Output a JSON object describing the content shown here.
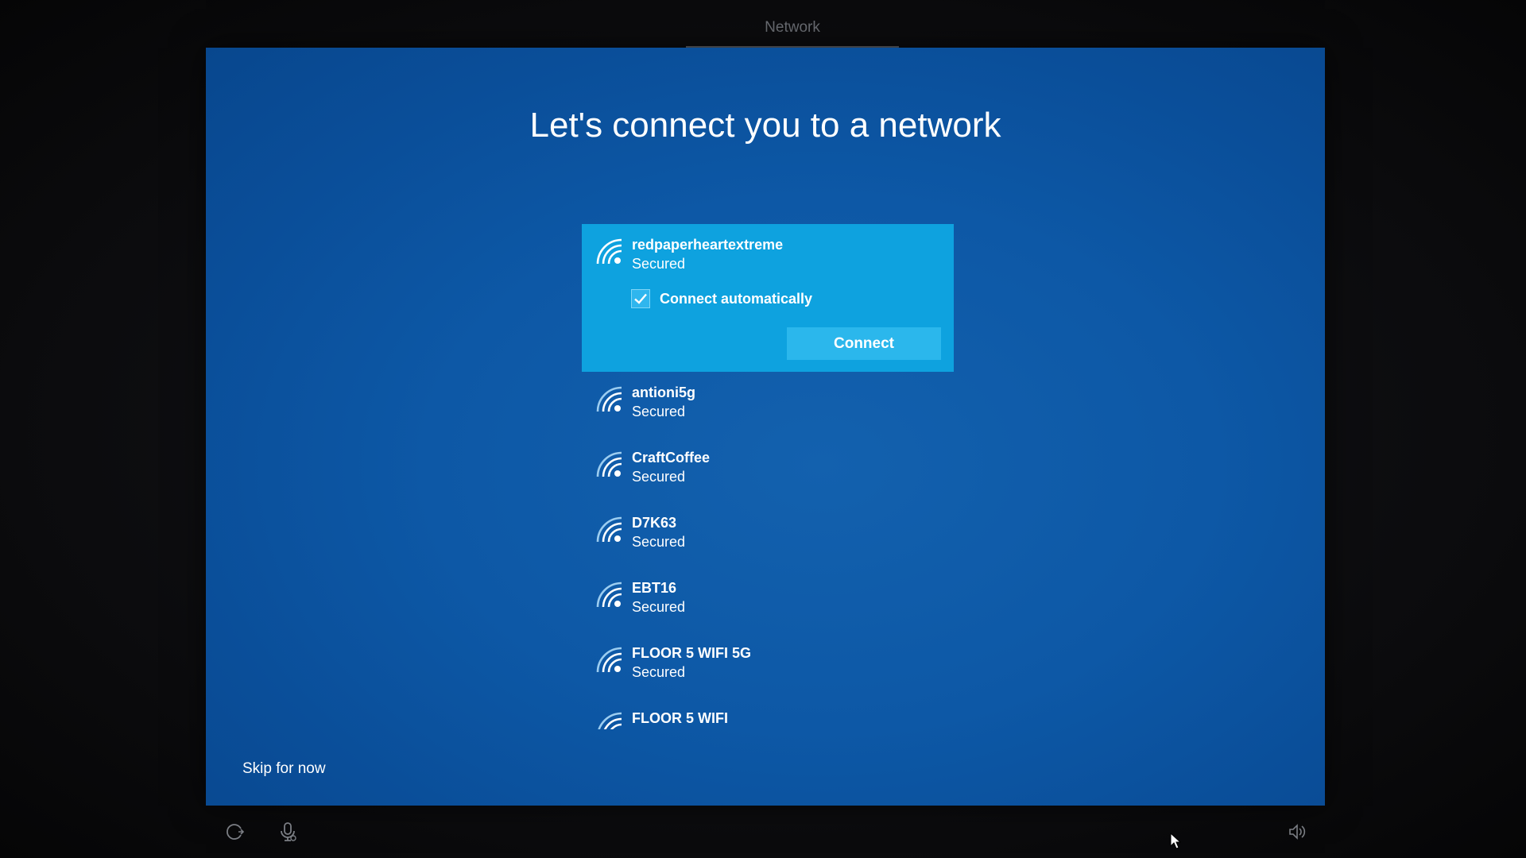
{
  "header": {
    "tab_title": "Network"
  },
  "main": {
    "heading": "Let's connect you to a network",
    "selected_network": {
      "name": "redpaperheartextreme",
      "status": "Secured",
      "connect_automatically_label": "Connect automatically",
      "connect_automatically_checked": true,
      "connect_button_label": "Connect"
    },
    "networks": [
      {
        "name": "antioni5g",
        "status": "Secured"
      },
      {
        "name": "CraftCoffee",
        "status": "Secured"
      },
      {
        "name": "D7K63",
        "status": "Secured"
      },
      {
        "name": "EBT16",
        "status": "Secured"
      },
      {
        "name": "FLOOR 5 WIFI 5G",
        "status": "Secured"
      },
      {
        "name": "FLOOR 5 WIFI",
        "status": ""
      }
    ],
    "skip_label": "Skip for now"
  },
  "footer": {
    "left_icons": [
      "ease-of-access-icon",
      "microphone-icon"
    ],
    "right_icons": [
      "volume-icon"
    ]
  },
  "icons": {
    "network": "wifi-signal-icon"
  },
  "colors": {
    "screen_bg": "#0d58a6",
    "selected_bg": "#0ea2df",
    "button_bg": "#2bb7ec",
    "text": "#ffffff"
  }
}
